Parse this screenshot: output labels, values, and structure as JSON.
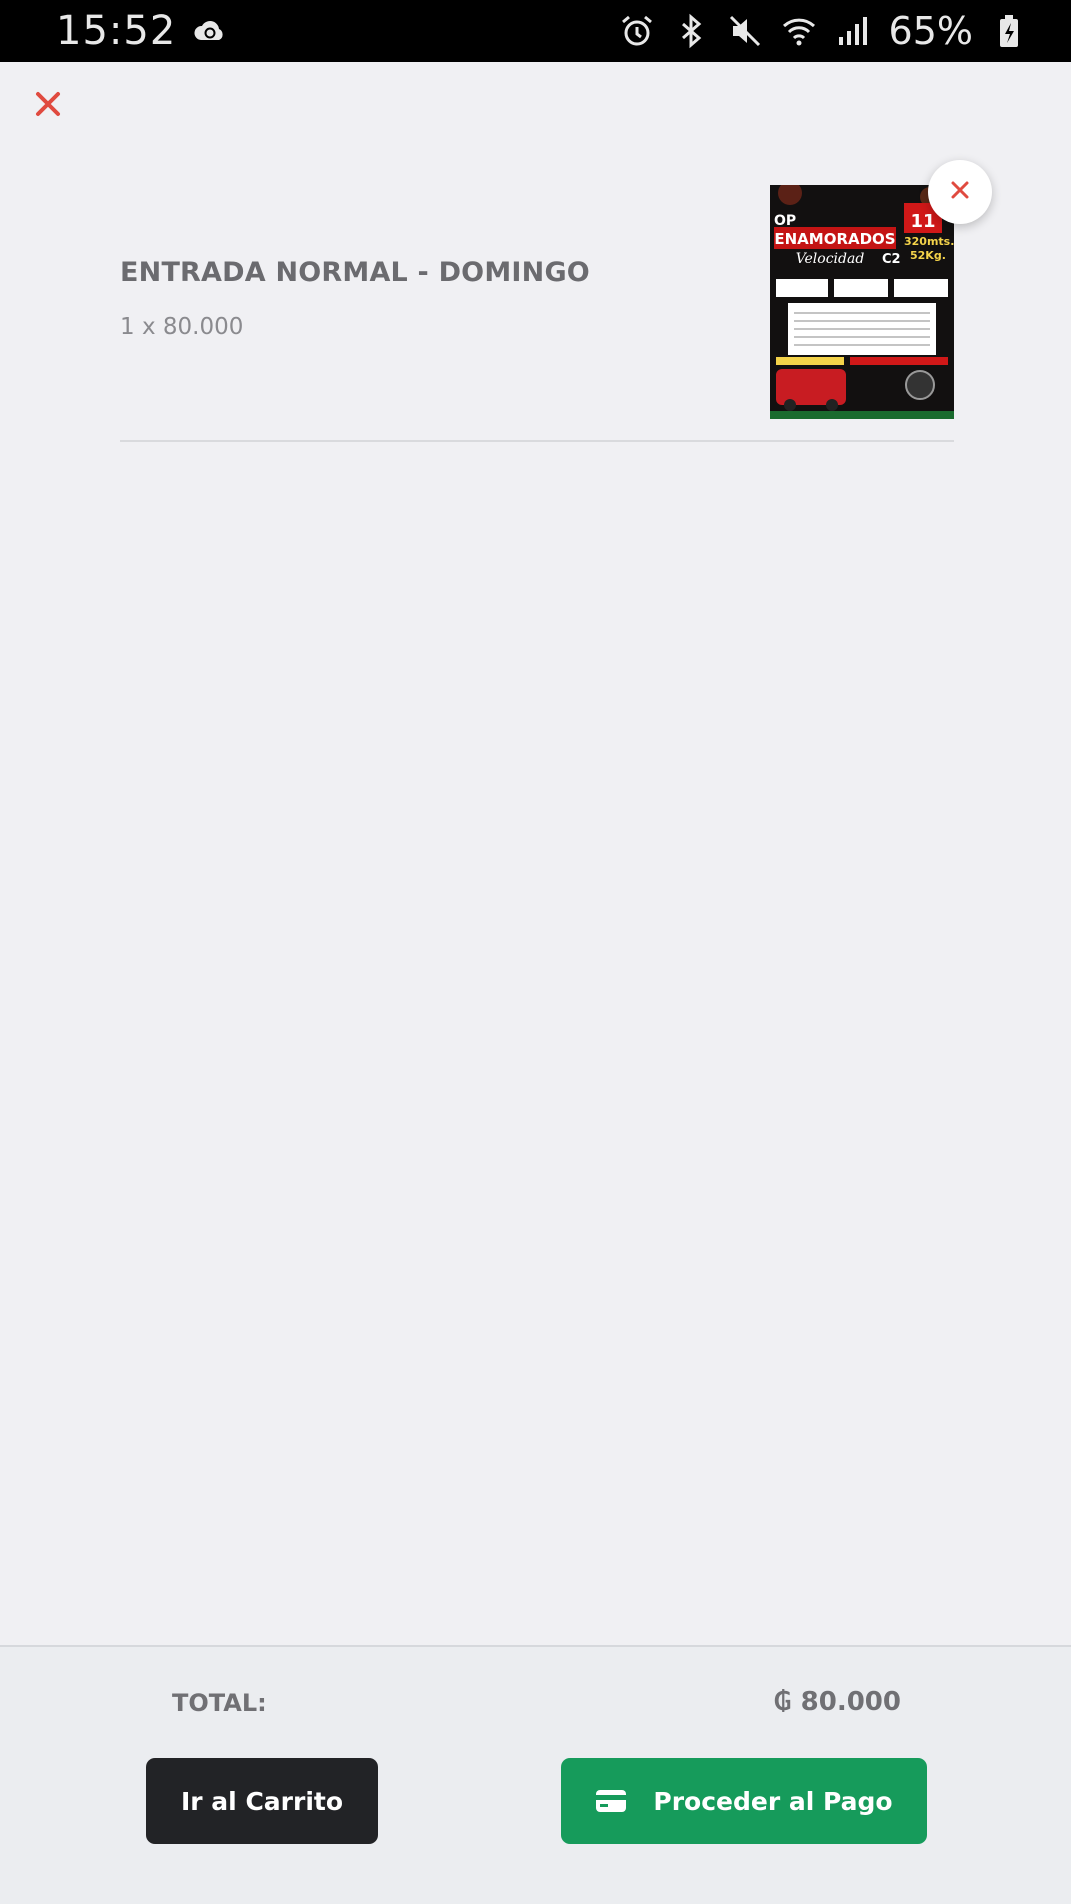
{
  "status_bar": {
    "time": "15:52",
    "battery": "65%",
    "icons": [
      "cloud-sync-icon",
      "alarm-icon",
      "bluetooth-icon",
      "mute-icon",
      "wifi-icon",
      "signal-icon",
      "battery-icon"
    ]
  },
  "header": {
    "close_icon": "close-icon",
    "accent_color": "#e04a3f"
  },
  "cart": {
    "items": [
      {
        "title": "ENTRADA NORMAL - DOMINGO",
        "quantity_price": "1 x 80.000",
        "image": {
          "headline": "ENAMORADOS",
          "subhead": "Velocidad",
          "tag": "C2",
          "prefix": "OP",
          "date_badge": "11",
          "distance": "320mts.",
          "weight": "52Kg."
        },
        "remove_icon": "close-icon"
      }
    ]
  },
  "footer": {
    "total_label": "TOTAL:",
    "total_value": "₲ 80.000",
    "cart_button": "Ir al Carrito",
    "pay_button": "Proceder al Pago",
    "pay_icon": "credit-card-icon",
    "colors": {
      "cart_button": "#222326",
      "pay_button": "#169b5b"
    }
  }
}
